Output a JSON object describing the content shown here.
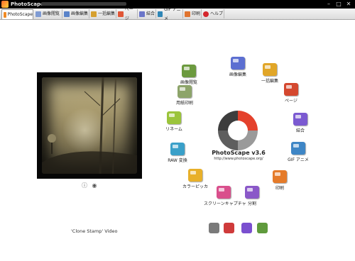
{
  "window": {
    "title": "PhotoScape",
    "controls": [
      "–",
      "□",
      "✕"
    ]
  },
  "tabs": [
    {
      "label": "PhotoScape",
      "icon": "photoscape-logo-icon",
      "color": "#f08a24"
    },
    {
      "label": "画像閲覧",
      "icon": "viewer-icon",
      "color": "#7f9bd3"
    },
    {
      "label": "画像編集",
      "icon": "editor-icon",
      "color": "#5a83c9"
    },
    {
      "label": "一括編集",
      "icon": "batch-icon",
      "color": "#d6a02f"
    },
    {
      "label": "ページ",
      "icon": "page-icon",
      "color": "#e05636"
    },
    {
      "label": "結合",
      "icon": "combine-icon",
      "color": "#6b76c9"
    },
    {
      "label": "GIF アニメ",
      "icon": "gif-icon",
      "color": "#2f86b6"
    },
    {
      "label": "印刷",
      "icon": "print-icon",
      "color": "#e0742f"
    },
    {
      "label": "ヘルプ",
      "icon": "help-icon",
      "color": "#d4262d"
    }
  ],
  "preview": {
    "caption": "'Clone Stamp' Video",
    "icons": [
      "info-icon",
      "camera-icon"
    ]
  },
  "logo": {
    "title": "PhotoScape v3.6",
    "url": "http://www.photoscape.org/"
  },
  "menu": [
    {
      "label": "画像閲覧",
      "icon": "viewer-icon",
      "color": "#6c9a3f"
    },
    {
      "label": "画像編集",
      "icon": "editor-icon",
      "color": "#5c6fd1"
    },
    {
      "label": "一括編集",
      "icon": "batch-icon",
      "color": "#e1a628"
    },
    {
      "label": "ページ",
      "icon": "page-icon",
      "color": "#d4482f"
    },
    {
      "label": "結合",
      "icon": "combine-icon",
      "color": "#7b5ad1"
    },
    {
      "label": "GIF アニメ",
      "icon": "gif-icon",
      "color": "#3e86c6"
    },
    {
      "label": "印刷",
      "icon": "print-icon",
      "color": "#e57b2a"
    },
    {
      "label": "分割",
      "icon": "split-icon",
      "color": "#8a58c8"
    },
    {
      "label": "スクリーンキャプチャ",
      "icon": "screen-capture-icon",
      "color": "#d94f8c"
    },
    {
      "label": "カラーピッカ",
      "icon": "color-picker-icon",
      "color": "#e8b02a"
    },
    {
      "label": "RAW 変換",
      "icon": "raw-convert-icon",
      "color": "#3aa0c9"
    },
    {
      "label": "リネーム",
      "icon": "rename-icon",
      "color": "#9bc43b"
    },
    {
      "label": "用紙印刷",
      "icon": "paper-print-icon",
      "color": "#8da46a"
    }
  ],
  "tools": [
    {
      "icon": "tools-icon",
      "color": "#7a7a7a"
    },
    {
      "icon": "language-icon",
      "color": "#cf3b3b"
    },
    {
      "icon": "user-icon",
      "color": "#7a4fcf"
    },
    {
      "icon": "image-icon",
      "color": "#5f9a3c"
    }
  ]
}
